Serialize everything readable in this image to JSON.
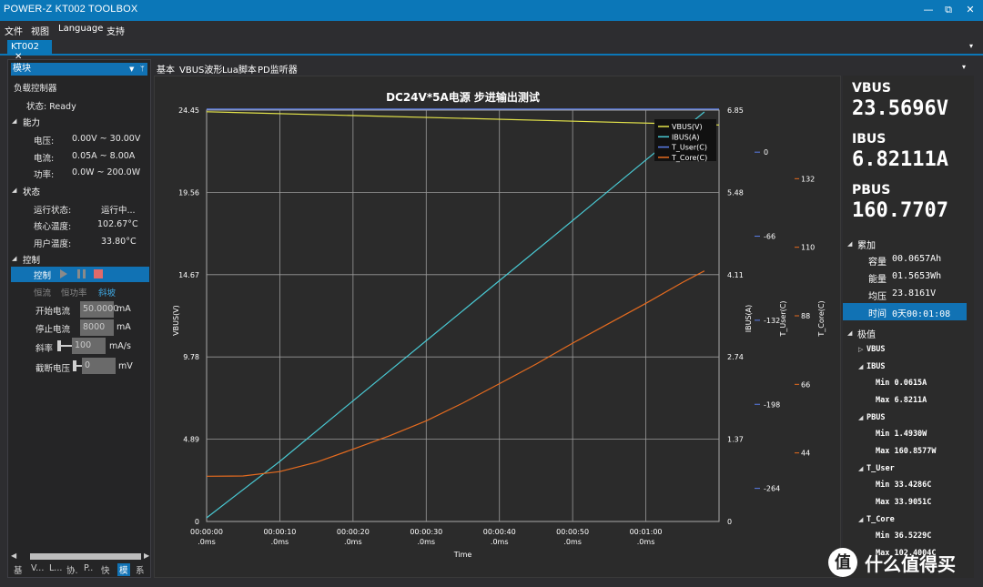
{
  "window": {
    "title": "POWER-Z KT002 TOOLBOX",
    "minimize": "—",
    "restore": "⧉",
    "close": "✕"
  },
  "menu": [
    "文件",
    "视图",
    "Language",
    "支持"
  ],
  "doc_tab": {
    "label": "KT002",
    "close": "✕"
  },
  "left": {
    "header": "模块",
    "module": "负载控制器",
    "status_label": "状态: Ready",
    "ability": {
      "title": "能力",
      "rows": [
        {
          "k": "电压:",
          "v": "0.00V ~ 30.00V"
        },
        {
          "k": "电流:",
          "v": "0.05A ~ 8.00A"
        },
        {
          "k": "功率:",
          "v": "0.0W ~ 200.0W"
        }
      ]
    },
    "state": {
      "title": "状态",
      "rows": [
        {
          "k": "运行状态:",
          "v": "运行中..."
        },
        {
          "k": "核心温度:",
          "v": "102.67°C"
        },
        {
          "k": "用户温度:",
          "v": "33.80°C"
        }
      ]
    },
    "control": {
      "title": "控制",
      "row_label": "控制",
      "modes": [
        "恒流",
        "恒功率",
        "斜坡"
      ],
      "fields": [
        {
          "k": "开始电流",
          "v": "50.0000",
          "u": "mA"
        },
        {
          "k": "停止电流",
          "v": "8000",
          "u": "mA"
        },
        {
          "k": "斜率",
          "v": "100",
          "u": "mA/s"
        },
        {
          "k": "截断电压",
          "v": "0",
          "u": "mV"
        }
      ]
    },
    "bottom_tabs": [
      "基",
      "V...",
      "L...",
      "协.",
      "P..",
      "快",
      "模",
      "系"
    ]
  },
  "tabs": [
    "基本",
    "VBUS波形",
    "Lua脚本",
    "PD监听器"
  ],
  "right": {
    "vbus": {
      "label": "VBUS",
      "value": "23.5696V"
    },
    "ibus": {
      "label": "IBUS",
      "value": "6.82111A"
    },
    "pbus": {
      "label": "PBUS",
      "value": "160.7707"
    },
    "acc_title": "累加",
    "acc": [
      {
        "k": "容量",
        "v": "00.0657Ah"
      },
      {
        "k": "能量",
        "v": "01.5653Wh"
      },
      {
        "k": "均压",
        "v": "23.8161V"
      },
      {
        "k": "时间",
        "v": "0天00:01:08"
      }
    ],
    "ext_title": "极值",
    "ext_vbus": "VBUS",
    "ext": [
      {
        "name": "IBUS",
        "min": "Min 0.0615A",
        "max": "Max 6.8211A"
      },
      {
        "name": "PBUS",
        "min": "Min 1.4930W",
        "max": "Max 160.8577W"
      },
      {
        "name": "T_User",
        "min": "Min 33.4286C",
        "max": "Max 33.9051C"
      },
      {
        "name": "T_Core",
        "min": "Min 36.5229C",
        "max": "Max 102.4004C"
      }
    ]
  },
  "chart_data": {
    "type": "line",
    "title": "DC24V*5A电源  步进输出测试",
    "xlabel": "Time",
    "x_ticks": [
      "00:00:00\n.0ms",
      "00:00:10\n.0ms",
      "00:00:20\n.0ms",
      "00:00:30\n.0ms",
      "00:00:40\n.0ms",
      "00:00:50\n.0ms",
      "00:01:00\n.0ms"
    ],
    "xlim": [
      0,
      70
    ],
    "axes": [
      {
        "label": "VBUS(V)",
        "side": "left",
        "ticks": [
          "24.45",
          "19.56",
          "14.67",
          "9.78",
          "4.89",
          "0"
        ],
        "range": [
          0,
          24.45
        ]
      },
      {
        "label": "IBUS(A)",
        "side": "right",
        "ticks": [
          "6.85",
          "5.48",
          "4.11",
          "2.74",
          "1.37",
          "0"
        ],
        "range": [
          0,
          6.85
        ]
      },
      {
        "label": "T_User(C)",
        "side": "right",
        "ticks": [
          "0",
          "-66",
          "-132",
          "-198",
          "-264"
        ],
        "range": [
          -290,
          33
        ]
      },
      {
        "label": "T_Core(C)",
        "side": "right",
        "ticks": [
          "132",
          "110",
          "88",
          "66",
          "44"
        ],
        "range": [
          22,
          154
        ]
      }
    ],
    "series": [
      {
        "name": "VBUS(V)",
        "axis": 0,
        "color": "#e3e34a",
        "x": [
          0,
          70
        ],
        "y": [
          24.35,
          23.57
        ]
      },
      {
        "name": "IBUS(A)",
        "axis": 1,
        "color": "#49c9d3",
        "x": [
          0,
          10,
          20,
          30,
          40,
          50,
          60,
          68
        ],
        "y": [
          0.06,
          1.0,
          2.01,
          3.01,
          4.01,
          5.01,
          6.02,
          6.82
        ]
      },
      {
        "name": "T_User(C)",
        "axis": 2,
        "color": "#5a7de8",
        "x": [
          0,
          70
        ],
        "y": [
          33.8,
          33.8
        ]
      },
      {
        "name": "T_Core(C)",
        "axis": 3,
        "color": "#e56b1f",
        "x": [
          0,
          5,
          10,
          15,
          20,
          25,
          30,
          35,
          40,
          45,
          50,
          55,
          60,
          65,
          68
        ],
        "y": [
          36.5,
          36.6,
          38,
          41,
          45.2,
          49.5,
          54.3,
          60,
          66.2,
          72.5,
          79.2,
          85.6,
          92,
          98.7,
          102.4
        ]
      }
    ],
    "legend": "top-right",
    "grid": true
  }
}
